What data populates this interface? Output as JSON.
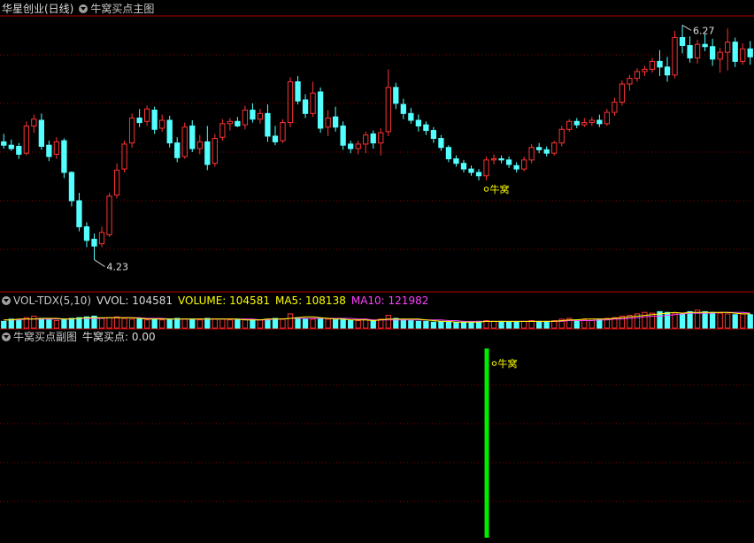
{
  "colors": {
    "up": "#ff3333",
    "down": "#54ffff",
    "grid": "#8a0000",
    "vol": "#ffffff",
    "ma5": "#ffff00",
    "ma10": "#ff40ff",
    "green": "#00ee00",
    "text": "#c8c8c8"
  },
  "main": {
    "stock_name": "华星创业(日线)",
    "indicator_name": "牛窝买点主图",
    "high_label": "6.27",
    "low_label": "4.23",
    "signal_label": "牛窝"
  },
  "vol_panel": {
    "indicator": "VOL-TDX(5,10)",
    "vvol": "VVOL: 104581",
    "volume": "VOLUME: 104581",
    "ma5": "MA5: 108138",
    "ma10": "MA10: 121982"
  },
  "sub_panel": {
    "indicator": "牛窝买点副图",
    "value": "牛窝买点: 0.00",
    "signal_label": "牛窝"
  },
  "chart_data": [
    {
      "type": "candlestick",
      "title": "华星创业(日线)",
      "series_name": "牛窝买点主图",
      "annotations": [
        {
          "text": "6.27",
          "type": "period_high"
        },
        {
          "text": "4.23",
          "type": "period_low"
        },
        {
          "text": "牛窝",
          "type": "signal",
          "bar_index": 64
        }
      ],
      "ohlc": [
        [
          5.27,
          5.34,
          5.21,
          5.24
        ],
        [
          5.24,
          5.29,
          5.19,
          5.21
        ],
        [
          5.23,
          5.26,
          5.12,
          5.16
        ],
        [
          5.17,
          5.45,
          5.15,
          5.41
        ],
        [
          5.41,
          5.51,
          5.35,
          5.47
        ],
        [
          5.46,
          5.52,
          5.2,
          5.23
        ],
        [
          5.24,
          5.28,
          5.1,
          5.14
        ],
        [
          5.16,
          5.31,
          5.12,
          5.27
        ],
        [
          5.28,
          5.3,
          4.95,
          5.0
        ],
        [
          5.0,
          5.01,
          4.7,
          4.75
        ],
        [
          4.75,
          4.82,
          4.48,
          4.52
        ],
        [
          4.52,
          4.56,
          4.34,
          4.4
        ],
        [
          4.41,
          4.46,
          4.23,
          4.35
        ],
        [
          4.37,
          4.52,
          4.34,
          4.47
        ],
        [
          4.45,
          4.82,
          4.43,
          4.79
        ],
        [
          4.8,
          5.08,
          4.77,
          5.02
        ],
        [
          5.03,
          5.28,
          5.0,
          5.25
        ],
        [
          5.26,
          5.52,
          5.22,
          5.48
        ],
        [
          5.48,
          5.56,
          5.4,
          5.44
        ],
        [
          5.45,
          5.59,
          5.41,
          5.56
        ],
        [
          5.55,
          5.58,
          5.34,
          5.38
        ],
        [
          5.39,
          5.51,
          5.36,
          5.46
        ],
        [
          5.46,
          5.5,
          5.22,
          5.26
        ],
        [
          5.26,
          5.31,
          5.09,
          5.13
        ],
        [
          5.14,
          5.44,
          5.12,
          5.4
        ],
        [
          5.41,
          5.46,
          5.18,
          5.21
        ],
        [
          5.21,
          5.33,
          5.16,
          5.27
        ],
        [
          5.27,
          5.41,
          5.02,
          5.07
        ],
        [
          5.08,
          5.34,
          5.05,
          5.3
        ],
        [
          5.31,
          5.47,
          5.28,
          5.43
        ],
        [
          5.43,
          5.48,
          5.37,
          5.45
        ],
        [
          5.45,
          5.49,
          5.4,
          5.41
        ],
        [
          5.42,
          5.59,
          5.38,
          5.55
        ],
        [
          5.55,
          5.61,
          5.44,
          5.47
        ],
        [
          5.47,
          5.56,
          5.43,
          5.52
        ],
        [
          5.52,
          5.6,
          5.27,
          5.32
        ],
        [
          5.32,
          5.41,
          5.24,
          5.27
        ],
        [
          5.28,
          5.47,
          5.26,
          5.44
        ],
        [
          5.44,
          5.84,
          5.4,
          5.8
        ],
        [
          5.8,
          5.85,
          5.6,
          5.63
        ],
        [
          5.64,
          5.69,
          5.48,
          5.52
        ],
        [
          5.52,
          5.8,
          5.49,
          5.7
        ],
        [
          5.71,
          5.75,
          5.35,
          5.39
        ],
        [
          5.4,
          5.55,
          5.32,
          5.48
        ],
        [
          5.49,
          5.58,
          5.36,
          5.4
        ],
        [
          5.41,
          5.45,
          5.2,
          5.24
        ],
        [
          5.25,
          5.28,
          5.17,
          5.21
        ],
        [
          5.21,
          5.28,
          5.16,
          5.25
        ],
        [
          5.25,
          5.36,
          5.17,
          5.33
        ],
        [
          5.34,
          5.37,
          5.21,
          5.26
        ],
        [
          5.26,
          5.39,
          5.15,
          5.35
        ],
        [
          5.36,
          5.91,
          5.32,
          5.75
        ],
        [
          5.75,
          5.79,
          5.56,
          5.61
        ],
        [
          5.6,
          5.65,
          5.47,
          5.52
        ],
        [
          5.52,
          5.57,
          5.43,
          5.46
        ],
        [
          5.46,
          5.51,
          5.36,
          5.41
        ],
        [
          5.42,
          5.45,
          5.33,
          5.37
        ],
        [
          5.37,
          5.4,
          5.26,
          5.3
        ],
        [
          5.3,
          5.33,
          5.19,
          5.22
        ],
        [
          5.22,
          5.24,
          5.09,
          5.12
        ],
        [
          5.12,
          5.15,
          5.05,
          5.08
        ],
        [
          5.08,
          5.11,
          5.0,
          5.03
        ],
        [
          5.03,
          5.06,
          4.97,
          5.0
        ],
        [
          5.0,
          5.03,
          4.93,
          4.97
        ],
        [
          4.97,
          5.14,
          4.93,
          5.11
        ],
        [
          5.11,
          5.16,
          5.07,
          5.12
        ],
        [
          5.12,
          5.15,
          5.08,
          5.11
        ],
        [
          5.11,
          5.14,
          5.04,
          5.07
        ],
        [
          5.06,
          5.09,
          5.0,
          5.03
        ],
        [
          5.03,
          5.14,
          5.01,
          5.11
        ],
        [
          5.11,
          5.25,
          5.08,
          5.22
        ],
        [
          5.22,
          5.26,
          5.17,
          5.2
        ],
        [
          5.2,
          5.23,
          5.14,
          5.17
        ],
        [
          5.17,
          5.28,
          5.15,
          5.26
        ],
        [
          5.26,
          5.41,
          5.23,
          5.38
        ],
        [
          5.38,
          5.47,
          5.36,
          5.45
        ],
        [
          5.45,
          5.48,
          5.39,
          5.42
        ],
        [
          5.42,
          5.48,
          5.4,
          5.44
        ],
        [
          5.44,
          5.49,
          5.41,
          5.46
        ],
        [
          5.46,
          5.51,
          5.4,
          5.43
        ],
        [
          5.43,
          5.56,
          5.41,
          5.53
        ],
        [
          5.53,
          5.66,
          5.5,
          5.62
        ],
        [
          5.62,
          5.81,
          5.59,
          5.78
        ],
        [
          5.78,
          5.86,
          5.72,
          5.83
        ],
        [
          5.83,
          5.92,
          5.8,
          5.89
        ],
        [
          5.89,
          5.94,
          5.85,
          5.91
        ],
        [
          5.91,
          6.01,
          5.88,
          5.98
        ],
        [
          5.98,
          6.08,
          5.85,
          5.93
        ],
        [
          5.93,
          6.02,
          5.8,
          5.86
        ],
        [
          5.86,
          6.25,
          5.83,
          6.19
        ],
        [
          6.19,
          6.3,
          6.05,
          6.12
        ],
        [
          6.12,
          6.2,
          5.97,
          6.01
        ],
        [
          6.01,
          6.17,
          5.96,
          6.13
        ],
        [
          6.13,
          6.22,
          6.07,
          6.11
        ],
        [
          6.11,
          6.18,
          5.94,
          6.0
        ],
        [
          6.0,
          6.1,
          5.88,
          6.06
        ],
        [
          6.06,
          6.27,
          5.9,
          6.15
        ],
        [
          6.15,
          6.19,
          5.93,
          5.98
        ],
        [
          5.98,
          6.14,
          5.95,
          6.09
        ],
        [
          6.09,
          6.16,
          5.95,
          6.02
        ]
      ]
    },
    {
      "type": "bar",
      "title": "VOL-TDX(5,10)",
      "series": [
        {
          "name": "VOLUME",
          "values": [
            9,
            12,
            11,
            14,
            16,
            13,
            11,
            10,
            12,
            13,
            14,
            15,
            16,
            13,
            14,
            15,
            13,
            12,
            12,
            11,
            12,
            11,
            12,
            13,
            12,
            12,
            11,
            13,
            12,
            12,
            11,
            11,
            12,
            11,
            11,
            12,
            13,
            12,
            19,
            14,
            13,
            12,
            13,
            12,
            11,
            11,
            10,
            10,
            11,
            10,
            12,
            17,
            13,
            11,
            10,
            9,
            9,
            8,
            9,
            8,
            8,
            8,
            8,
            9,
            10,
            9,
            9,
            8,
            8,
            9,
            10,
            9,
            9,
            10,
            12,
            13,
            11,
            11,
            12,
            12,
            13,
            14,
            16,
            17,
            19,
            21,
            20,
            22,
            21,
            20,
            19,
            22,
            24,
            22,
            21,
            20,
            19,
            18,
            19,
            18
          ]
        },
        {
          "name": "MA5",
          "values": [
            11,
            11,
            12,
            12,
            12,
            13,
            13,
            13,
            12,
            12,
            13,
            14,
            14,
            14,
            14,
            14,
            14,
            14,
            13,
            12,
            12,
            12,
            12,
            12,
            12,
            12,
            12,
            12,
            12,
            12,
            12,
            12,
            11,
            11,
            11,
            12,
            12,
            12,
            13,
            14,
            15,
            15,
            14,
            13,
            12,
            12,
            11,
            11,
            11,
            10,
            11,
            12,
            12,
            12,
            12,
            12,
            11,
            10,
            9,
            9,
            8,
            8,
            8,
            8,
            9,
            9,
            9,
            9,
            9,
            9,
            9,
            9,
            9,
            9,
            10,
            11,
            11,
            12,
            12,
            12,
            12,
            13,
            14,
            15,
            16,
            17,
            18,
            19,
            20,
            21,
            20,
            21,
            21,
            21,
            21,
            21,
            21,
            20,
            19,
            19
          ]
        },
        {
          "name": "MA10",
          "values": [
            11,
            11,
            11,
            12,
            12,
            12,
            12,
            12,
            12,
            12,
            13,
            13,
            13,
            13,
            14,
            14,
            14,
            14,
            14,
            13,
            13,
            13,
            12,
            12,
            12,
            12,
            12,
            12,
            12,
            12,
            12,
            12,
            12,
            12,
            11,
            11,
            12,
            12,
            13,
            13,
            13,
            13,
            13,
            13,
            13,
            13,
            13,
            12,
            12,
            11,
            11,
            11,
            11,
            11,
            11,
            11,
            11,
            11,
            11,
            10,
            10,
            9,
            9,
            9,
            9,
            9,
            9,
            9,
            9,
            9,
            9,
            9,
            9,
            9,
            9,
            10,
            10,
            10,
            10,
            11,
            11,
            12,
            12,
            13,
            14,
            15,
            16,
            16,
            17,
            18,
            19,
            20,
            20,
            20,
            20,
            21,
            21,
            21,
            21,
            20
          ]
        }
      ]
    },
    {
      "type": "bar",
      "title": "牛窝买点副图",
      "series": [
        {
          "name": "牛窝买点",
          "signal_bar_index": 64,
          "value": 1
        }
      ]
    }
  ]
}
